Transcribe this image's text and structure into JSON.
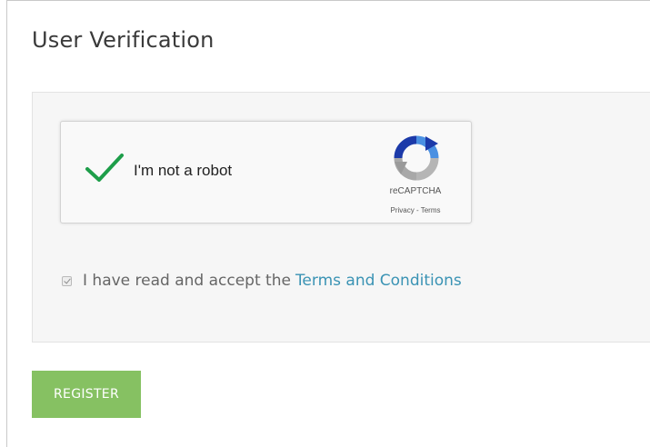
{
  "page": {
    "title": "User Verification"
  },
  "recaptcha": {
    "label": "I'm not a robot",
    "checked": true,
    "brand": "reCAPTCHA",
    "links": "Privacy - Terms",
    "check_icon": "checkmark-icon",
    "logo_icon": "recaptcha-logo-icon",
    "check_color": "#1e9e4a"
  },
  "terms": {
    "checked": true,
    "text": "I have read and accept the",
    "link_label": "Terms and Conditions",
    "link_color": "#3a93b4"
  },
  "actions": {
    "register_label": "REGISTER",
    "register_color": "#86c162"
  }
}
